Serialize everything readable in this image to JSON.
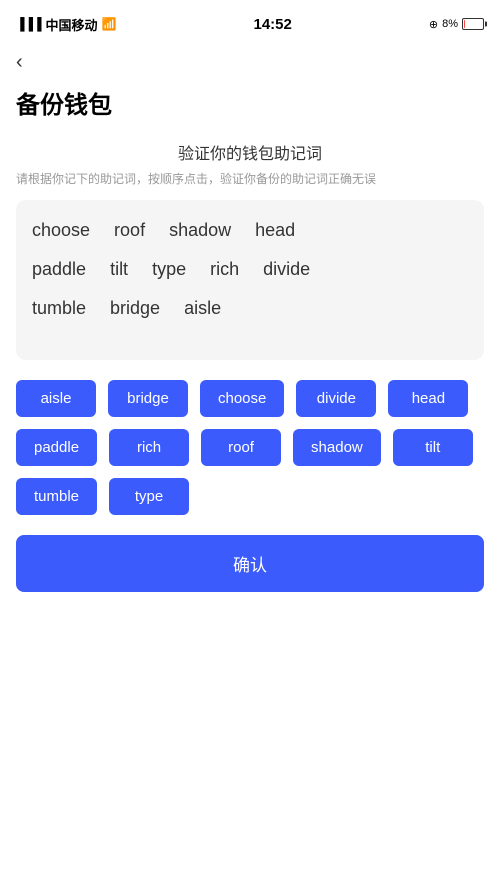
{
  "statusBar": {
    "carrier": "中国移动",
    "time": "14:52",
    "battery": "8%"
  },
  "backLabel": "‹",
  "pageTitle": "备份钱包",
  "sectionTitle": "验证你的钱包助记词",
  "sectionDesc": "请根据你记下的助记词，按顺序点击，验证你备份的助记词正确无误",
  "displayWords": {
    "row1": [
      "choose",
      "roof",
      "shadow",
      "head"
    ],
    "row2": [
      "paddle",
      "tilt",
      "type",
      "rich",
      "divide"
    ],
    "row3": [
      "tumble",
      "bridge",
      "aisle"
    ]
  },
  "wordButtons": [
    "aisle",
    "bridge",
    "choose",
    "divide",
    "head",
    "paddle",
    "rich",
    "roof",
    "shadow",
    "tilt",
    "tumble",
    "type"
  ],
  "confirmLabel": "确认"
}
